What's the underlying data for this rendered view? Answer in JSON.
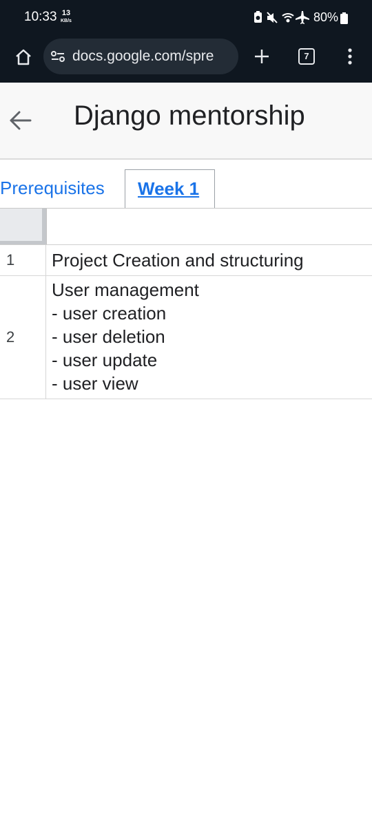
{
  "status": {
    "time": "10:33",
    "speed_value": "13",
    "speed_unit": "KB/s",
    "battery": "80%"
  },
  "browser": {
    "url": "docs.google.com/spre",
    "tab_count": "7"
  },
  "doc": {
    "title": "Django mentorship"
  },
  "sheet_tabs": [
    {
      "label": "Prerequisites",
      "active": false
    },
    {
      "label": "Week 1",
      "active": true
    }
  ],
  "rows": [
    {
      "num": "1",
      "lines": [
        "Project Creation and structuring"
      ]
    },
    {
      "num": "2",
      "lines": [
        "User management",
        "- user creation",
        "- user deletion",
        "- user update",
        "- user view"
      ]
    }
  ],
  "colors": {
    "bar_bg": "#0f1720",
    "link": "#1a73e8",
    "app_bar_bg": "#f8f8f8"
  }
}
